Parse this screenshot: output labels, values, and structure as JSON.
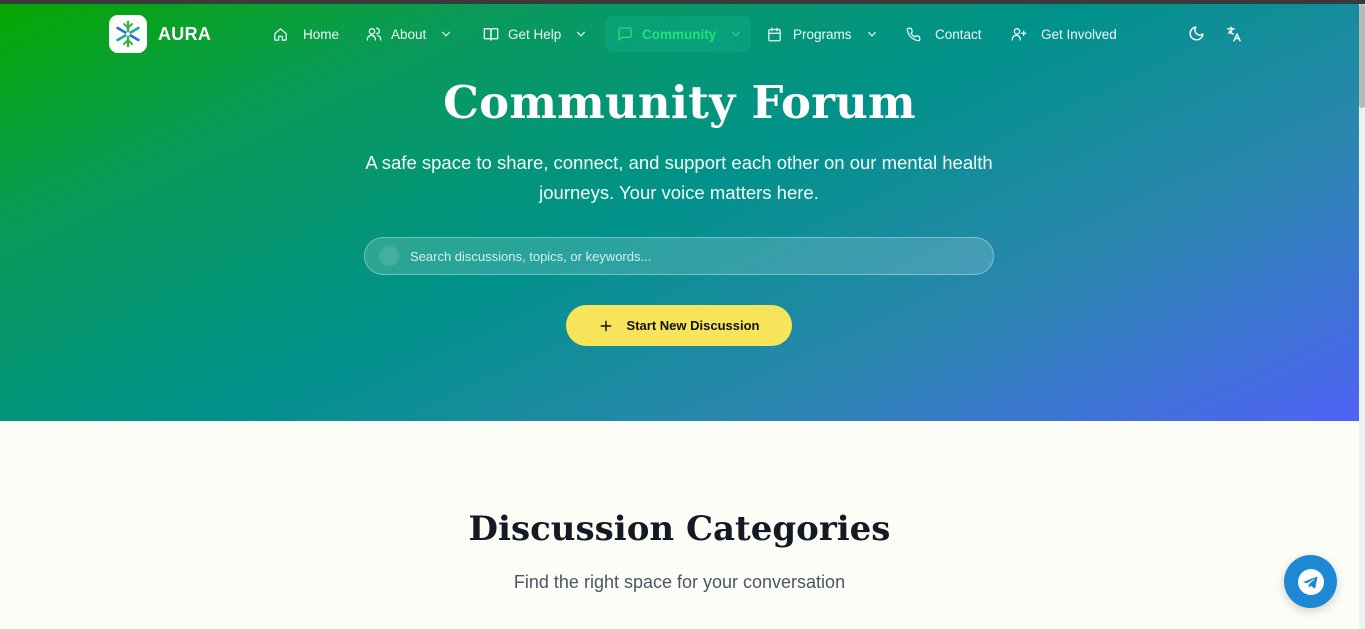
{
  "brand": {
    "name": "AURA"
  },
  "nav": {
    "items": [
      {
        "label": "Home",
        "icon": "home-icon",
        "dropdown": false
      },
      {
        "label": "About",
        "icon": "users-icon",
        "dropdown": true
      },
      {
        "label": "Get Help",
        "icon": "book-open-icon",
        "dropdown": true
      },
      {
        "label": "Community",
        "icon": "message-square-icon",
        "dropdown": true,
        "active": true
      },
      {
        "label": "Programs",
        "icon": "calendar-icon",
        "dropdown": true
      },
      {
        "label": "Contact",
        "icon": "phone-icon",
        "dropdown": false
      },
      {
        "label": "Get Involved",
        "icon": "user-plus-icon",
        "dropdown": false
      }
    ],
    "theme_toggle_icon": "moon-icon",
    "language_icon": "translate-icon"
  },
  "hero": {
    "title": "Community Forum",
    "subtitle": "A safe space to share, connect, and support each other on our mental health journeys. Your voice matters here.",
    "search_placeholder": "Search discussions, topics, or keywords...",
    "search_value": "",
    "cta_label": "Start New Discussion"
  },
  "categories": {
    "title": "Discussion Categories",
    "subtitle": "Find the right space for your conversation"
  },
  "colors": {
    "gradient_start": "#06a700",
    "gradient_mid": "#00928a",
    "gradient_end": "#4f63f6",
    "active_nav": "#22e07a",
    "cta_bg": "#f8e45a",
    "fab_bg": "#1f88d4",
    "page_bg": "#fdfdf8"
  }
}
